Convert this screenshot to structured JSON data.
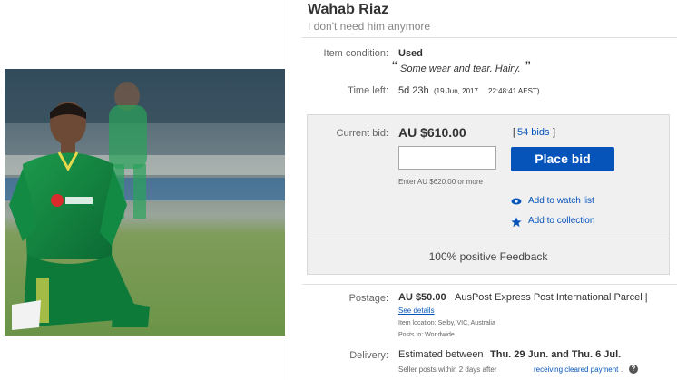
{
  "listing": {
    "title": "Wahab Riaz",
    "subtitle": "I don't need him anymore"
  },
  "condition": {
    "label": "Item condition:",
    "value": "Used",
    "open_quote": "“",
    "note": "Some wear and tear. Hairy.",
    "close_quote": "”"
  },
  "time": {
    "label": "Time left:",
    "value": "5d 23h",
    "detail": "(19 Jun, 2017",
    "clock": "22:48:41 AEST)"
  },
  "bid": {
    "label": "Current bid:",
    "amount": "AU $610.00",
    "bids_open": "[",
    "bids_link": "54 bids",
    "bids_close": "]",
    "input_value": "",
    "hint": "Enter AU $620.00 or more",
    "place_bid_label": "Place bid",
    "watch_label": "Add to watch list",
    "collection_label": "Add to collection",
    "feedback": "100% positive Feedback"
  },
  "postage": {
    "label": "Postage:",
    "amount": "AU $50.00",
    "service": "AusPost Express Post International Parcel |",
    "details_link": "See details",
    "location": "Item location:  Selby, VIC, Australia",
    "posts_to": "Posts to:  Worldwide"
  },
  "delivery": {
    "label": "Delivery:",
    "prefix": "Estimated between",
    "range": "Thu. 29 Jun. and Thu. 6 Jul.",
    "seller_prefix": "Seller posts within 2 days after",
    "seller_link": "receiving cleared payment",
    "seller_suffix": "."
  },
  "colors": {
    "accent": "#0654ba",
    "panel": "#f0f0f1",
    "jersey": "#0f7a3c",
    "grass": "#6f9a4e"
  },
  "icons": [
    "eye-icon",
    "star-icon",
    "help-icon"
  ]
}
